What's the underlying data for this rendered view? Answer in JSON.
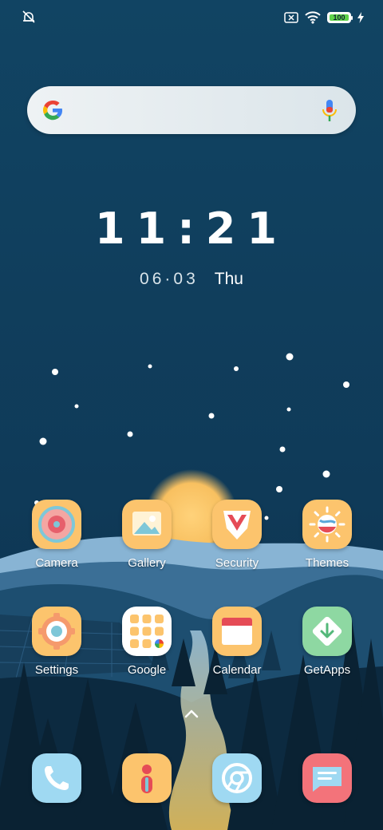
{
  "status_bar": {
    "left_icon": "alarm-off-icon",
    "right_icons": [
      "sim-error-icon",
      "wifi-icon",
      "battery-icon",
      "charging-bolt-icon"
    ],
    "battery_level": "100"
  },
  "search": {
    "logo": "google-g-icon",
    "mic": "microphone-icon"
  },
  "clock": {
    "time": "11:21",
    "date": "06·03",
    "weekday": "Thu"
  },
  "apps": [
    {
      "label": "Camera",
      "icon": "camera-icon"
    },
    {
      "label": "Gallery",
      "icon": "gallery-icon"
    },
    {
      "label": "Security",
      "icon": "security-icon"
    },
    {
      "label": "Themes",
      "icon": "themes-icon"
    },
    {
      "label": "Settings",
      "icon": "settings-icon"
    },
    {
      "label": "Google",
      "icon": "google-folder-icon"
    },
    {
      "label": "Calendar",
      "icon": "calendar-icon"
    },
    {
      "label": "GetApps",
      "icon": "getapps-icon"
    }
  ],
  "dock": [
    {
      "icon": "phone-icon"
    },
    {
      "icon": "contacts-icon"
    },
    {
      "icon": "chrome-icon"
    },
    {
      "icon": "messages-icon"
    }
  ],
  "colors": {
    "icon_background": "#fcc46d",
    "sky": "#0f3d5c",
    "battery_green": "#5fd34a"
  }
}
